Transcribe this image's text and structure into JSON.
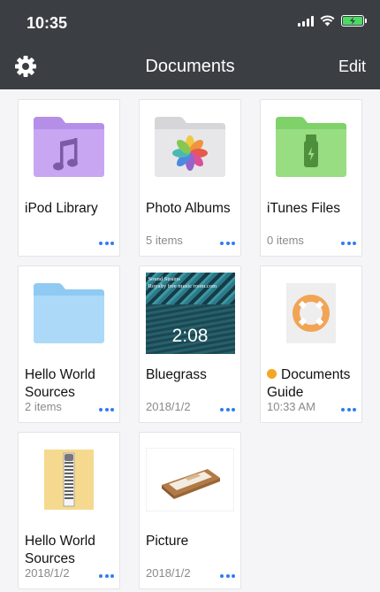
{
  "status": {
    "time": "10:35"
  },
  "nav": {
    "title": "Documents",
    "edit_label": "Edit"
  },
  "items": [
    {
      "name": "iPod Library",
      "meta": "",
      "icon": "music-folder-icon"
    },
    {
      "name": "Photo Albums",
      "meta": "5 items",
      "icon": "photos-folder-icon"
    },
    {
      "name": "iTunes Files",
      "meta": "0 items",
      "icon": "usb-folder-icon"
    },
    {
      "name": "Hello World Sources",
      "meta": "2 items",
      "icon": "folder-icon"
    },
    {
      "name": "Bluegrass",
      "meta": "2018/1/2",
      "icon": "video-thumbnail",
      "duration": "2:08",
      "caption_line1": "Sound Strains",
      "caption_line2": "Royalty free music room.com"
    },
    {
      "name": "Documents Guide",
      "meta": "10:33 AM",
      "icon": "lifebuoy-icon"
    },
    {
      "name": "Hello World Sources",
      "meta": "2018/1/2",
      "icon": "zip-archive-icon"
    },
    {
      "name": "Picture",
      "meta": "2018/1/2",
      "icon": "picture-icon"
    }
  ],
  "colors": {
    "topbar": "#3b3f44",
    "accent": "#2f7cf6",
    "battery": "#4cd964",
    "badge": "#f5a623"
  }
}
